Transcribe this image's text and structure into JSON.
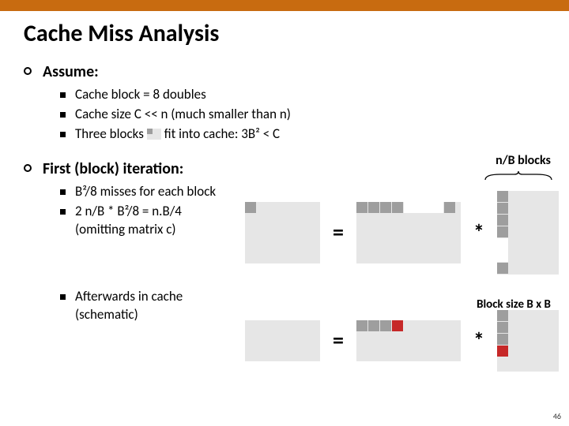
{
  "title": "Cache Miss Analysis",
  "sections": {
    "assume": {
      "label": "Assume:",
      "items": [
        "Cache block = 8 doubles",
        "Cache size C << n (much smaller than n)",
        {
          "pre": "Three blocks ",
          "post": " fit into cache: 3B² < C"
        }
      ]
    },
    "first_iter": {
      "label": "First (block) iteration:",
      "items": [
        "B²/8 misses for each block",
        "2 n/B * B²/8 = n.B/4\n(omitting matrix c)",
        "Afterwards in cache\n(schematic)"
      ]
    }
  },
  "labels": {
    "nb_blocks": "n/B blocks",
    "block_size": "Block size B x B",
    "equals": "=",
    "star": "*"
  },
  "page_number": "46"
}
